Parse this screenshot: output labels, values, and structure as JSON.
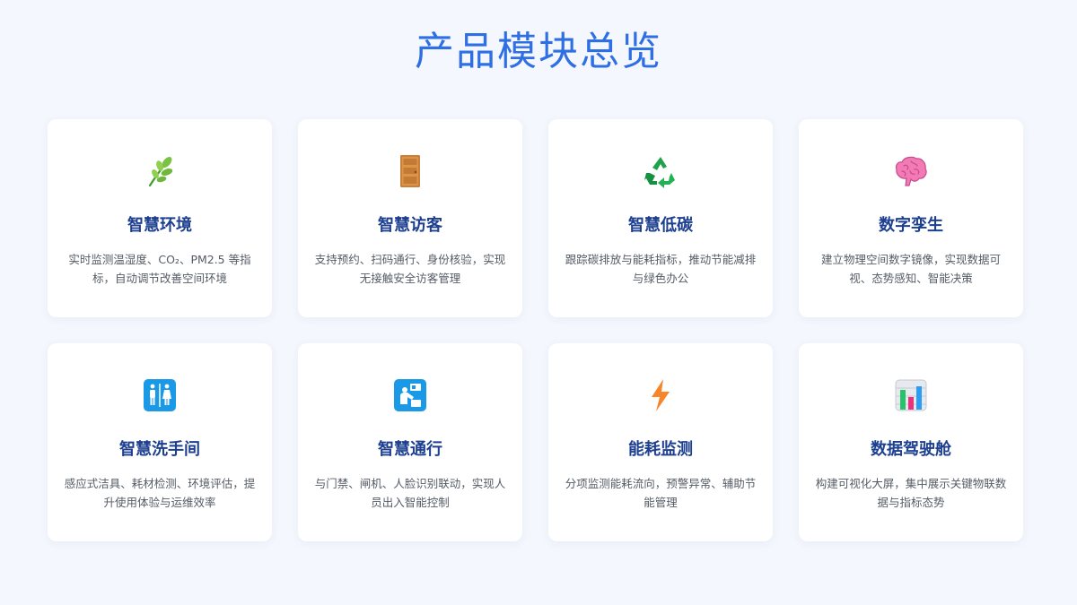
{
  "page": {
    "title": "产品模块总览"
  },
  "colors": {
    "background": "#f4f7fd",
    "title": "#2f6fe4",
    "card_title": "#1d3f8f",
    "card_text": "#555c66"
  },
  "modules": [
    {
      "title": "智慧环境",
      "description": "实时监测温湿度、CO₂、PM2.5 等指标，自动调节改善空间环境",
      "icon": "herb-icon"
    },
    {
      "title": "智慧访客",
      "description": "支持预约、扫码通行、身份核验，实现无接触安全访客管理",
      "icon": "door-icon"
    },
    {
      "title": "智慧低碳",
      "description": "跟踪碳排放与能耗指标，推动节能减排与绿色办公",
      "icon": "recycle-icon"
    },
    {
      "title": "数字孪生",
      "description": "建立物理空间数字镜像，实现数据可视、态势感知、智能决策",
      "icon": "brain-icon"
    },
    {
      "title": "智慧洗手间",
      "description": "感应式洁具、耗材检测、环境评估，提升使用体验与运维效率",
      "icon": "restroom-icon"
    },
    {
      "title": "智慧通行",
      "description": "与门禁、闸机、人脸识别联动，实现人员出入智能控制",
      "icon": "passport-control-icon"
    },
    {
      "title": "能耗监测",
      "description": "分项监测能耗流向，预警异常、辅助节能管理",
      "icon": "lightning-icon"
    },
    {
      "title": "数据驾驶舱",
      "description": "构建可视化大屏，集中展示关键物联数据与指标态势",
      "icon": "bar-chart-icon"
    }
  ]
}
